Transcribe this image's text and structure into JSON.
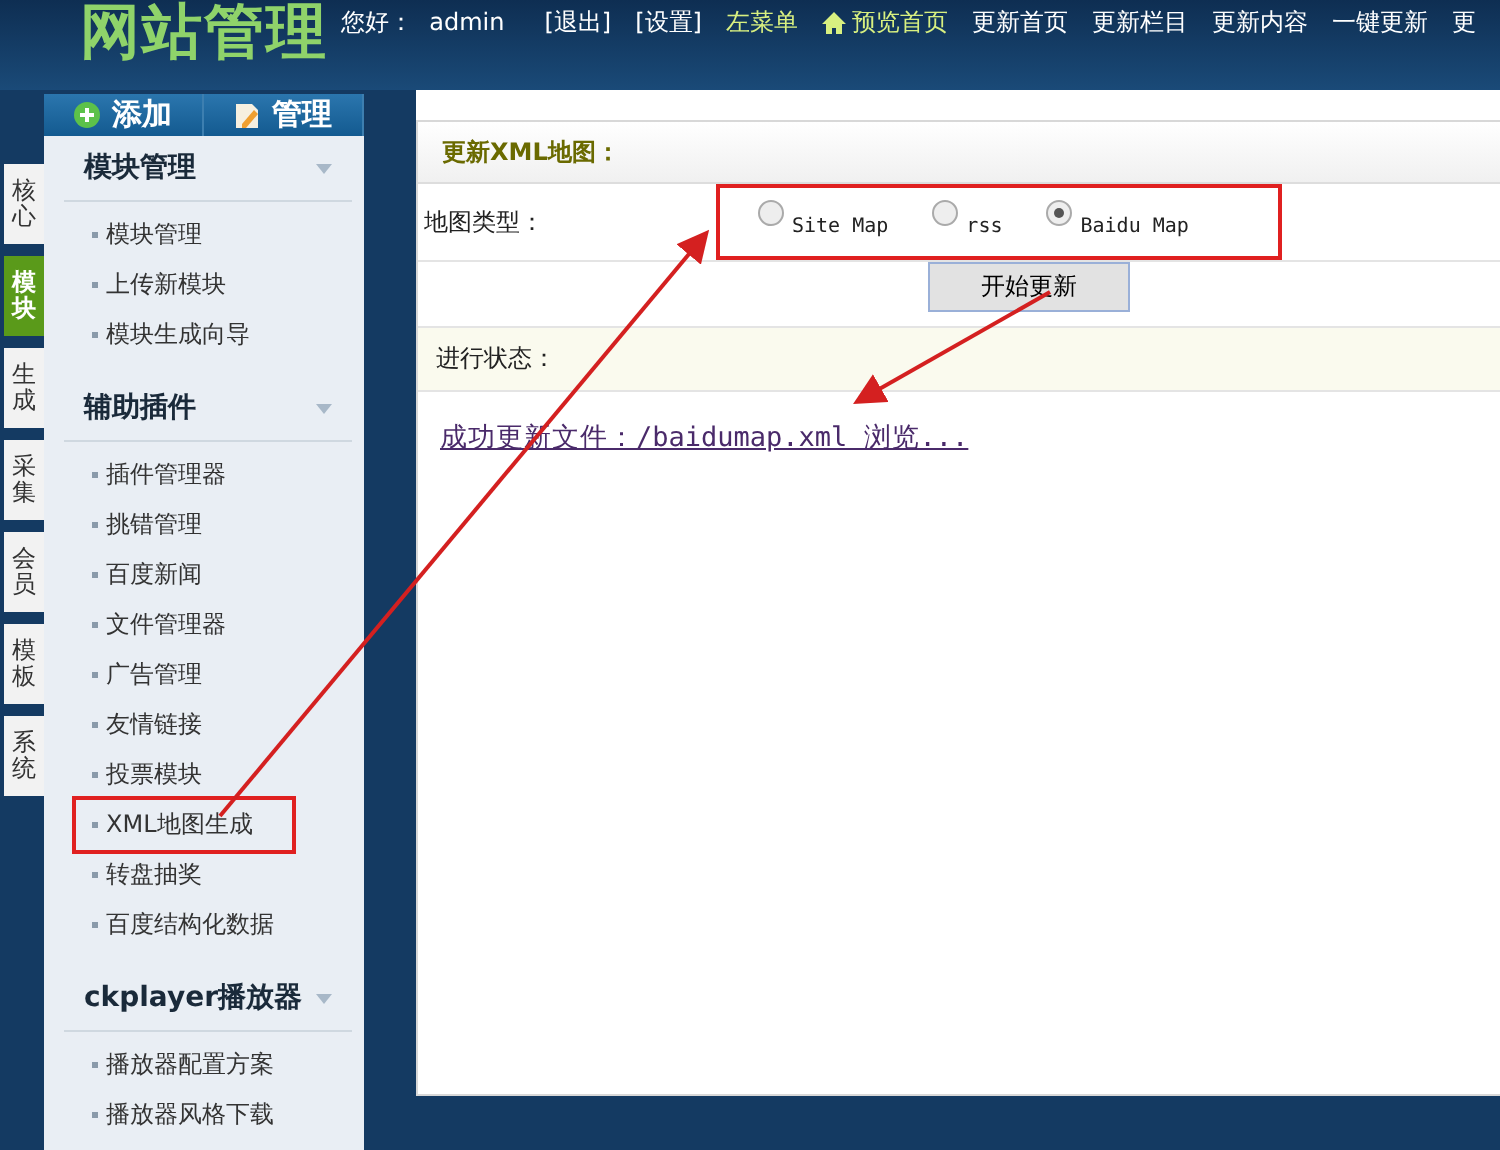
{
  "header": {
    "logo": "网站管理",
    "greeting": "您好：",
    "user": "admin",
    "nav": [
      {
        "label": "[退出]",
        "kind": "plain"
      },
      {
        "label": "[设置]",
        "kind": "plain"
      },
      {
        "label": "左菜单",
        "kind": "highlight"
      },
      {
        "label": "预览首页",
        "kind": "home"
      },
      {
        "label": "更新首页",
        "kind": "plain"
      },
      {
        "label": "更新栏目",
        "kind": "plain"
      },
      {
        "label": "更新内容",
        "kind": "plain"
      },
      {
        "label": "一键更新",
        "kind": "plain"
      },
      {
        "label": "更",
        "kind": "plain"
      }
    ]
  },
  "side_tabs": [
    {
      "label": "核心",
      "selected": false
    },
    {
      "label": "模块",
      "selected": true
    },
    {
      "label": "生成",
      "selected": false
    },
    {
      "label": "采集",
      "selected": false
    },
    {
      "label": "会员",
      "selected": false
    },
    {
      "label": "模板",
      "selected": false
    },
    {
      "label": "系统",
      "selected": false
    }
  ],
  "sidebar": {
    "buttons": [
      {
        "label": "添加",
        "kind": "add"
      },
      {
        "label": "管理",
        "kind": "manage"
      }
    ],
    "sections": [
      {
        "title": "模块管理",
        "items": [
          {
            "label": "模块管理",
            "annotated": false
          },
          {
            "label": "上传新模块",
            "annotated": false
          },
          {
            "label": "模块生成向导",
            "annotated": false
          }
        ]
      },
      {
        "title": "辅助插件",
        "items": [
          {
            "label": "插件管理器",
            "annotated": false
          },
          {
            "label": "挑错管理",
            "annotated": false
          },
          {
            "label": "百度新闻",
            "annotated": false
          },
          {
            "label": "文件管理器",
            "annotated": false
          },
          {
            "label": "广告管理",
            "annotated": false
          },
          {
            "label": "友情链接",
            "annotated": false
          },
          {
            "label": "投票模块",
            "annotated": false
          },
          {
            "label": "XML地图生成",
            "annotated": true
          },
          {
            "label": "转盘抽奖",
            "annotated": false
          },
          {
            "label": "百度结构化数据",
            "annotated": false
          }
        ]
      },
      {
        "title": "ckplayer播放器",
        "items": [
          {
            "label": "播放器配置方案",
            "annotated": false
          },
          {
            "label": "播放器风格下载",
            "annotated": false
          }
        ]
      }
    ]
  },
  "main": {
    "title": "更新XML地图：",
    "map_type": {
      "label": "地图类型：",
      "annotated": true,
      "options": [
        {
          "label": "Site Map",
          "selected": false
        },
        {
          "label": "rss",
          "selected": false
        },
        {
          "label": "Baidu Map",
          "selected": true
        }
      ]
    },
    "button": "开始更新",
    "status": {
      "label": "进行状态："
    },
    "result_link": "成功更新文件：/baidumap.xml 浏览..."
  }
}
